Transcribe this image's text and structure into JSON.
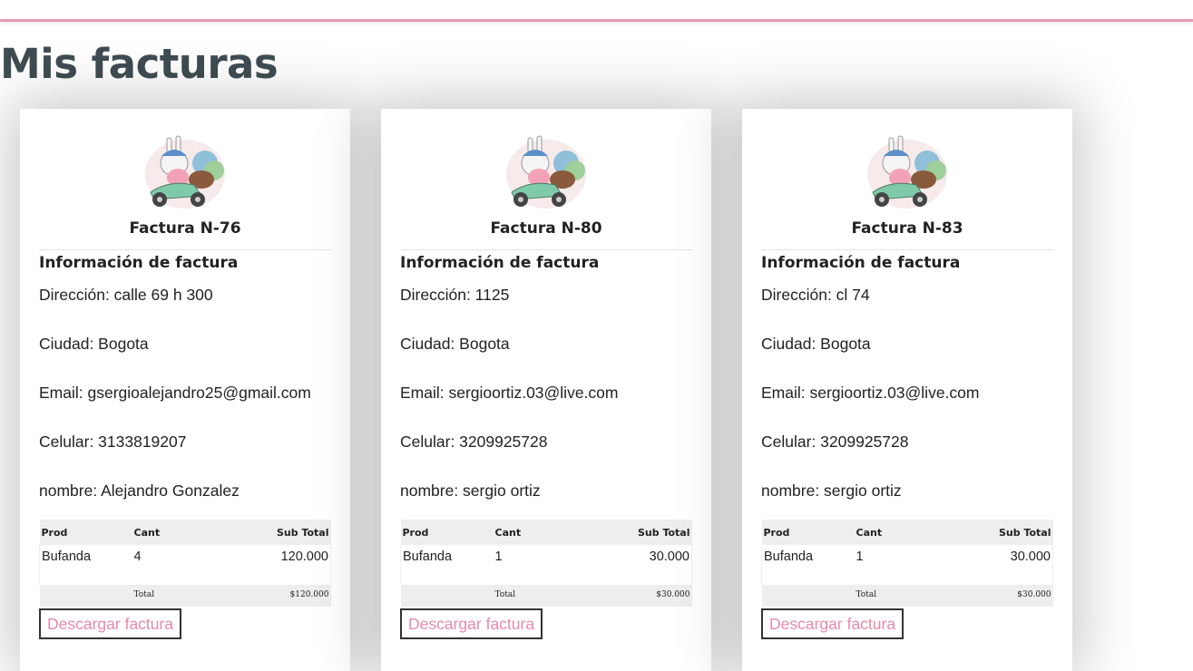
{
  "page": {
    "title": "Mis facturas"
  },
  "invoices": [
    {
      "title": "Factura N-76",
      "info_heading": "Información de factura",
      "direccion": "Dirección: calle 69 h 300",
      "ciudad": "Ciudad: Bogota",
      "email": "Email: gsergioalejandro25@gmail.com",
      "celular": "Celular: 3133819207",
      "nombre": "nombre: Alejandro Gonzalez",
      "table": {
        "headers": [
          "Prod",
          "Cant",
          "Sub Total"
        ],
        "rows": [
          {
            "prod": "Bufanda",
            "cant": "4",
            "subtotal": "120.000"
          }
        ],
        "total_label": "Total",
        "total_value": "$120.000"
      },
      "download_label": "Descargar factura"
    },
    {
      "title": "Factura N-80",
      "info_heading": "Información de factura",
      "direccion": "Dirección: 1125",
      "ciudad": "Ciudad: Bogota",
      "email": "Email: sergioortiz.03@live.com",
      "celular": "Celular: 3209925728",
      "nombre": "nombre: sergio ortiz",
      "table": {
        "headers": [
          "Prod",
          "Cant",
          "Sub Total"
        ],
        "rows": [
          {
            "prod": "Bufanda",
            "cant": "1",
            "subtotal": "30.000"
          }
        ],
        "total_label": "Total",
        "total_value": "$30.000"
      },
      "download_label": "Descargar factura"
    },
    {
      "title": "Factura N-83",
      "info_heading": "Información de factura",
      "direccion": "Dirección: cl 74",
      "ciudad": "Ciudad: Bogota",
      "email": "Email: sergioortiz.03@live.com",
      "celular": "Celular: 3209925728",
      "nombre": "nombre: sergio ortiz",
      "table": {
        "headers": [
          "Prod",
          "Cant",
          "Sub Total"
        ],
        "rows": [
          {
            "prod": "Bufanda",
            "cant": "1",
            "subtotal": "30.000"
          }
        ],
        "total_label": "Total",
        "total_value": "$30.000"
      },
      "download_label": "Descargar factura"
    }
  ],
  "colors": {
    "accent": "#e88aac",
    "title": "#3f4d52",
    "header_line": "#e89ab6"
  },
  "icons": {
    "logo": "bunny-scooter-logo"
  }
}
